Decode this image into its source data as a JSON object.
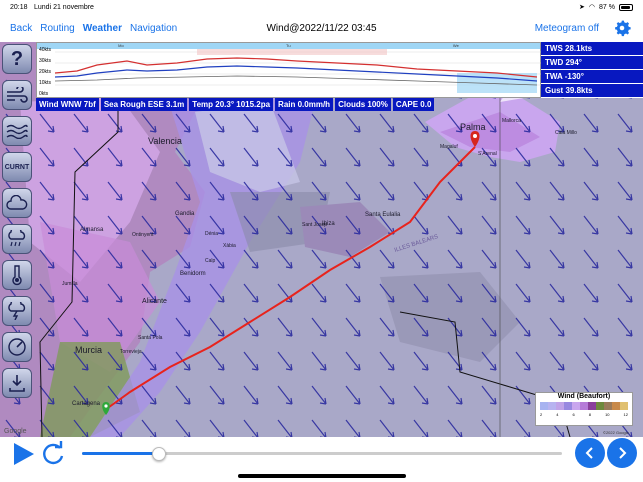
{
  "status": {
    "time": "20:18",
    "date": "Lundi 21 novembre",
    "battery": "87 %",
    "battery_level": 0.87
  },
  "nav": {
    "back": "Back",
    "routing": "Routing",
    "weather": "Weather",
    "navigation": "Navigation",
    "title": "Wind@2022/11/22 03:45",
    "meteogram": "Meteogram off"
  },
  "chart": {
    "ylabels": [
      "40kts",
      "30kts",
      "20kts",
      "10kts",
      "0kts"
    ],
    "top_ticks": [
      "Mo",
      "Tu",
      "We"
    ]
  },
  "panel": {
    "tws": "TWS 28.1kts",
    "twd": "TWD 294°",
    "twa": "TWA -130°",
    "gust": "Gust 39.8kts"
  },
  "info": {
    "wind": "Wind WNW 7bf",
    "sea": "Sea Rough ESE 3.1m",
    "temp": "Temp 20.3° 1015.2pa",
    "rain": "Rain 0.0mm/h",
    "clouds": "Clouds 100%",
    "cape": "CAPE 0.0"
  },
  "sidebar": {
    "current": "CURNT"
  },
  "map": {
    "places": [
      "Valencia",
      "Palma",
      "Mallorca",
      "Cala Millo",
      "Magaluf",
      "S'Arenal",
      "Ibiza",
      "Santa Eulalia",
      "Sant Josep",
      "Gandia",
      "Benidorm",
      "Alicante",
      "Almansa",
      "Murcia",
      "Cartagena",
      "Torrevieja",
      "Santa Pola",
      "Jumilla",
      "Ontinyent",
      "Calp",
      "Dénia",
      "Xàbia",
      "ILLES BALEARS"
    ],
    "attribution": "©2022 Google",
    "google": "Google"
  },
  "legend": {
    "title": "Wind (Beaufort)",
    "numbers": [
      "2",
      "4",
      "6",
      "8",
      "10",
      "12"
    ],
    "colors": [
      "#a7b3f0",
      "#b7b3f0",
      "#c0a3e8",
      "#9888e0",
      "#c9a6ee",
      "#b67bd8",
      "#8a3f9b",
      "#6e8a3c",
      "#9a7b5a",
      "#c88a4a",
      "#e0c070"
    ]
  },
  "timeline": {
    "progress": 0.16
  }
}
